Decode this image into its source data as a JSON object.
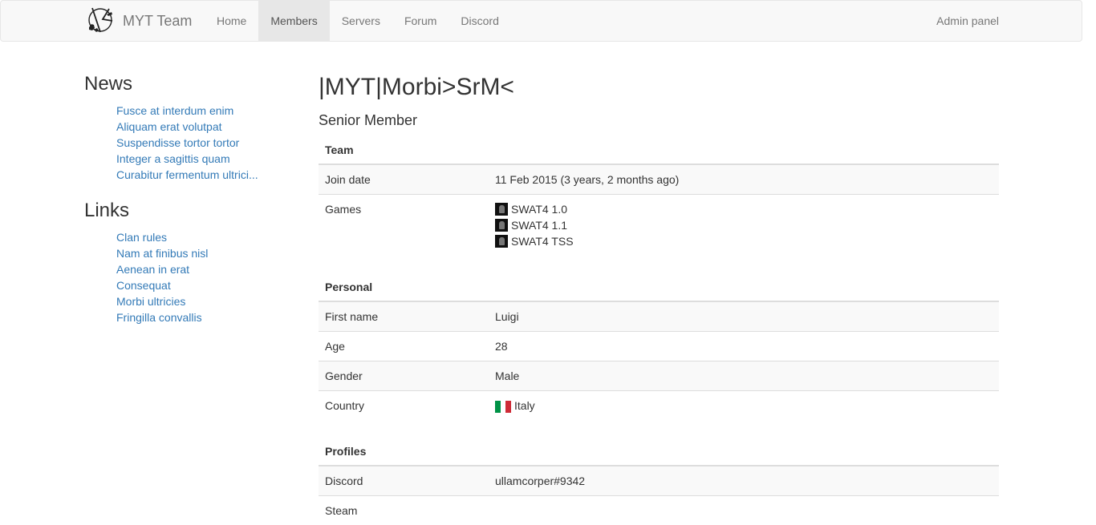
{
  "brand": {
    "name": "MYT Team",
    "logo_icon": "myt-logo-icon"
  },
  "nav": {
    "items": [
      {
        "label": "Home",
        "active": false
      },
      {
        "label": "Members",
        "active": true
      },
      {
        "label": "Servers",
        "active": false
      },
      {
        "label": "Forum",
        "active": false
      },
      {
        "label": "Discord",
        "active": false
      }
    ],
    "right": "Admin panel"
  },
  "sidebar": {
    "news_heading": "News",
    "news": [
      "Fusce at interdum enim",
      "Aliquam erat volutpat",
      "Suspendisse tortor tortor",
      "Integer a sagittis quam",
      "Curabitur fermentum ultrici..."
    ],
    "links_heading": "Links",
    "links": [
      "Clan rules",
      "Nam at finibus nisl",
      "Aenean in erat",
      "Consequat",
      "Morbi ultricies",
      "Fringilla convallis"
    ]
  },
  "profile": {
    "title": "|MYT|Morbi>SrM<",
    "rank": "Senior Member",
    "team": {
      "heading": "Team",
      "join_label": "Join date",
      "join_value": "11 Feb 2015 (3 years, 2 months ago)",
      "games_label": "Games",
      "games": [
        "SWAT4 1.0",
        "SWAT4 1.1",
        "SWAT4 TSS"
      ]
    },
    "personal": {
      "heading": "Personal",
      "first_name_label": "First name",
      "first_name_value": "Luigi",
      "age_label": "Age",
      "age_value": "28",
      "gender_label": "Gender",
      "gender_value": "Male",
      "country_label": "Country",
      "country_value": "Italy",
      "country_flag_colors": [
        "#009246",
        "#ffffff",
        "#ce2b37"
      ]
    },
    "profiles": {
      "heading": "Profiles",
      "discord_label": "Discord",
      "discord_value": "ullamcorper#9342",
      "next_label": "Steam"
    }
  }
}
